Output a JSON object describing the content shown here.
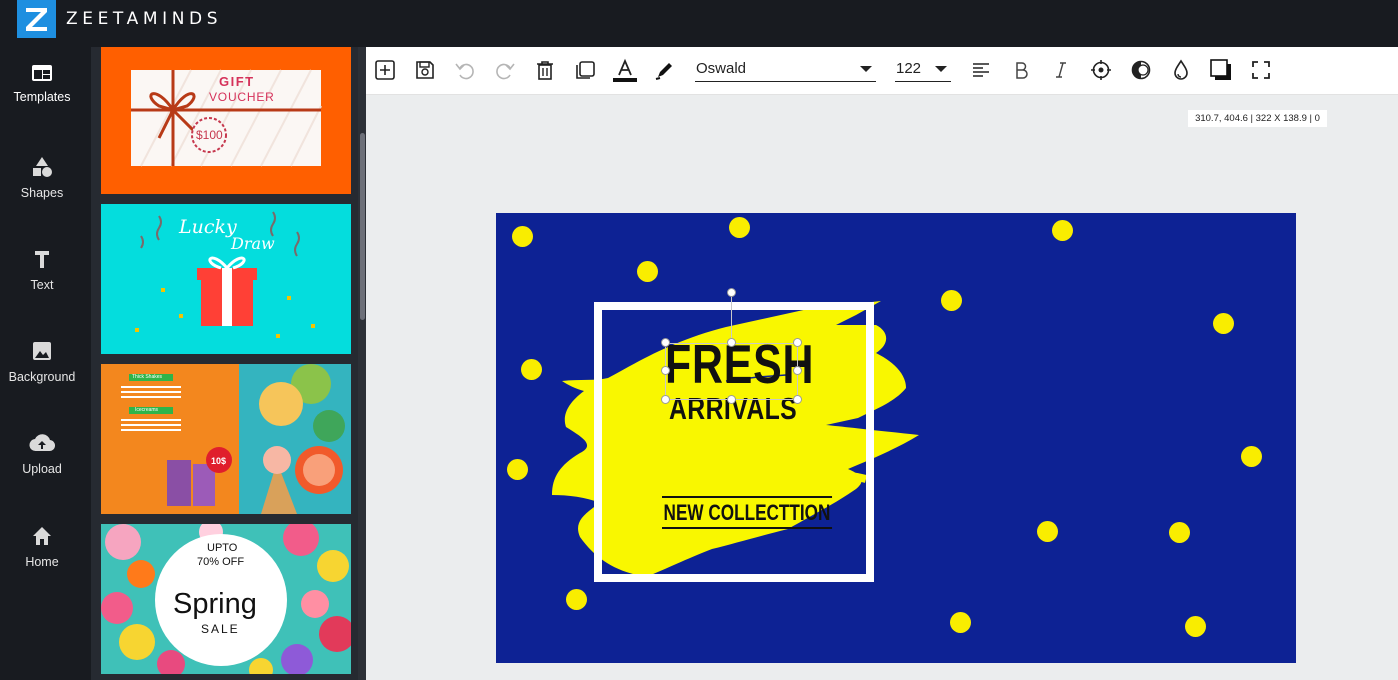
{
  "app": {
    "name": "ZEETAMINDS"
  },
  "nav": {
    "items": [
      {
        "label": "Templates",
        "icon": "templates-icon"
      },
      {
        "label": "Shapes",
        "icon": "shapes-icon"
      },
      {
        "label": "Text",
        "icon": "text-icon"
      },
      {
        "label": "Background",
        "icon": "background-icon"
      },
      {
        "label": "Upload",
        "icon": "upload-icon"
      },
      {
        "label": "Home",
        "icon": "home-icon"
      }
    ]
  },
  "templates": [
    {
      "name": "gift-voucher",
      "texts": [
        "GIFT",
        "VOUCHER",
        "$100"
      ]
    },
    {
      "name": "lucky-draw",
      "texts": [
        "Lucky",
        "Draw"
      ]
    },
    {
      "name": "thick-shakes-menu",
      "texts": [
        "Thick Shakes",
        "Icecreams",
        "10$"
      ]
    },
    {
      "name": "spring-sale",
      "texts": [
        "UPTO",
        "70% OFF",
        "Spring",
        "SALE"
      ]
    }
  ],
  "toolbar": {
    "font": "Oswald",
    "font_size": "122",
    "icons": [
      "add-icon",
      "save-icon",
      "undo-icon",
      "redo-icon",
      "delete-icon",
      "duplicate-icon",
      "text-color-icon",
      "pen-icon",
      "align-left-icon",
      "bold-icon",
      "italic-icon",
      "position-icon",
      "contrast-icon",
      "opacity-icon",
      "shadow-icon",
      "fullscreen-icon"
    ]
  },
  "selection": {
    "info": "310.7, 404.6 | 322 X 138.9 | 0"
  },
  "design": {
    "headline": "FRESH",
    "subheadline": "ARRIVALS",
    "tagline": "NEW COLLECTTION"
  },
  "colors": {
    "topbar": "#181b20",
    "panel": "#262a31",
    "canvas_bg": "#0d2294",
    "accent_yellow": "#f9ed00",
    "logo_blue": "#1e8fe0"
  }
}
